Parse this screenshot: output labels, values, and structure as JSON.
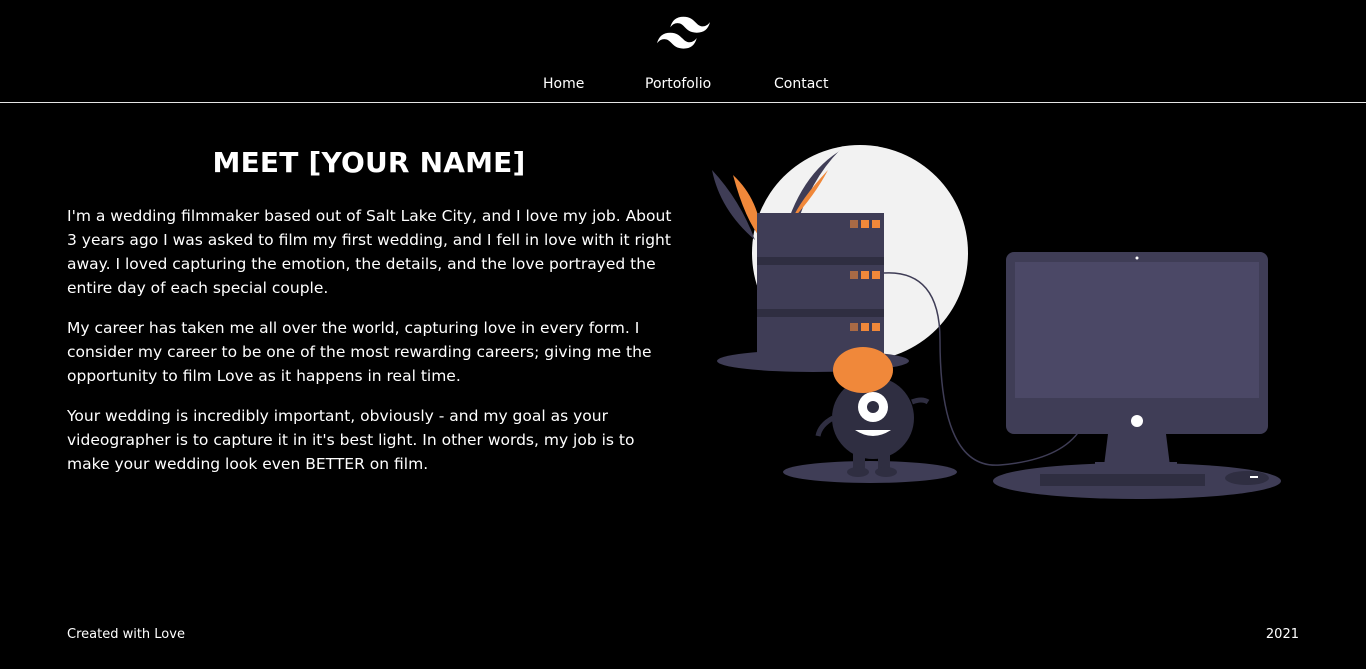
{
  "header": {
    "logo_icon": "tailwind-wave-logo",
    "nav": [
      {
        "label": "Home"
      },
      {
        "label": "Portofolio"
      },
      {
        "label": "Contact"
      }
    ]
  },
  "main": {
    "title": "MEET [YOUR NAME]",
    "paragraphs": [
      "I'm a wedding filmmaker based out of Salt Lake City, and I love my job. About 3 years ago I was asked to film my first wedding, and I fell in love with it right away. I loved capturing the emotion, the details, and the love portrayed the entire day of each special couple.",
      "My career has taken me all over the world, capturing love in every form. I consider my career to be one of the most rewarding careers; giving me the opportunity to film Love as it happens in real time.",
      "Your wedding is incredibly important, obviously - and my goal as your videographer is to capture it in it's best light. In other words, my job is to make your wedding look even BETTER on film."
    ],
    "illustration_icon": "server-monster-computer-illustration"
  },
  "footer": {
    "left": "Created with Love",
    "right": "2021"
  },
  "colors": {
    "background": "#000000",
    "text": "#ffffff",
    "accent": "#f0883a",
    "illustration_dark": "#3f3d56",
    "illustration_light": "#f2f2f2"
  }
}
